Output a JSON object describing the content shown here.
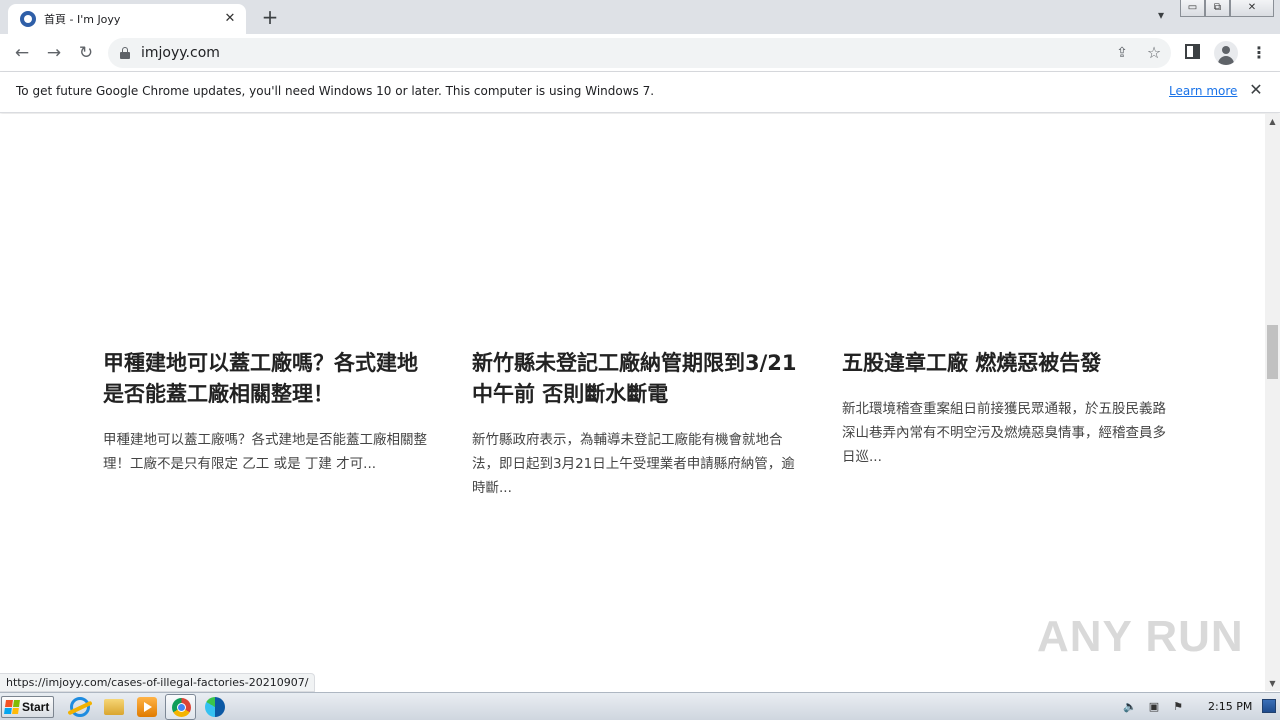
{
  "browser": {
    "tab": {
      "title": "首頁 - I'm Joyy"
    },
    "url": "imjoyy.com",
    "window_buttons": {
      "minimize": "▭",
      "restore": "⧉",
      "close": "✕"
    }
  },
  "infobar": {
    "message": "To get future Google Chrome updates, you'll need Windows 10 or later. This computer is using Windows 7.",
    "link": "Learn more"
  },
  "articles": [
    {
      "title": "甲種建地可以蓋工廠嗎？各式建地是否能蓋工廠相關整理！",
      "excerpt": "甲種建地可以蓋工廠嗎？各式建地是否能蓋工廠相關整理！工廠不是只有限定 乙工 或是 丁建 才可..."
    },
    {
      "title": "新竹縣未登記工廠納管期限到3/21中午前 否則斷水斷電",
      "excerpt": "新竹縣政府表示，為輔導未登記工廠能有機會就地合法，即日起到3月21日上午受理業者申請縣府納管，逾時斷..."
    },
    {
      "title": "五股違章工廠 燃燒惡被告發",
      "excerpt": "新北環境稽查重案組日前接獲民眾通報，於五股民義路深山巷弄內常有不明空污及燃燒惡臭情事，經稽查員多日巡..."
    }
  ],
  "status_url": "https://imjoyy.com/cases-of-illegal-factories-20210907/",
  "watermark": "ANY RUN",
  "taskbar": {
    "start_label": "Start",
    "clock": "2:15 PM"
  },
  "colors": {
    "link": "#1a73e8",
    "tabstrip": "#dee1e6",
    "omnibox": "#f1f3f4"
  }
}
